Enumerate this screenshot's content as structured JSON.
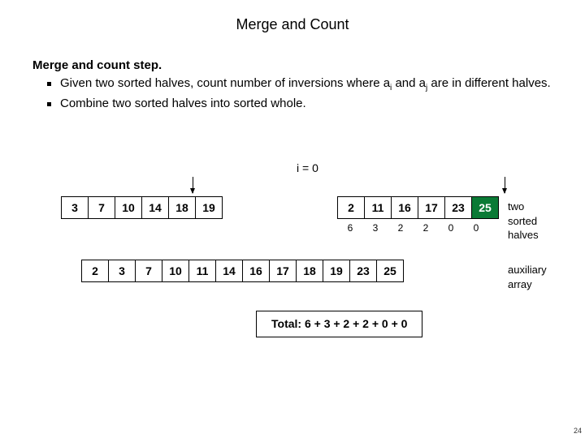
{
  "title": "Merge and Count",
  "step_header": "Merge and count step.",
  "bullet1_pre": "Given two sorted halves, count number of inversions where a",
  "bullet1_mid": " and a",
  "bullet1_post": " are in different halves.",
  "sub_i": "i",
  "sub_j": "j",
  "bullet2": "Combine two sorted halves into sorted whole.",
  "i_label": "i = 0",
  "left_half": [
    "3",
    "7",
    "10",
    "14",
    "18",
    "19"
  ],
  "right_half": [
    "2",
    "11",
    "16",
    "17",
    "23",
    "25"
  ],
  "right_green_last": true,
  "counts_under_right": [
    "6",
    "3",
    "2",
    "2",
    "0",
    "0"
  ],
  "aux_array": [
    "2",
    "3",
    "7",
    "10",
    "11",
    "14",
    "16",
    "17",
    "18",
    "19",
    "23",
    "25"
  ],
  "label_halves": "two sorted halves",
  "label_aux": "auxiliary array",
  "total_text": "Total:  6 + 3 + 2 + 2 + 0 + 0",
  "page_number": "24"
}
